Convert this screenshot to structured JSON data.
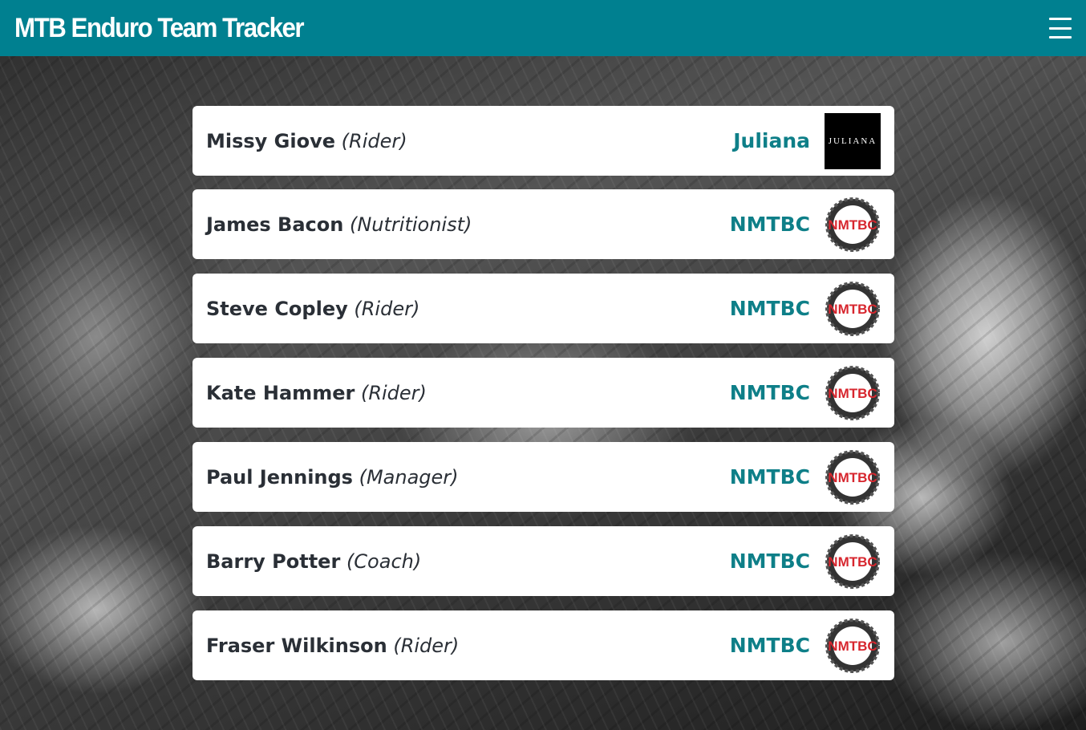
{
  "app": {
    "title": "MTB Enduro Team Tracker"
  },
  "header": {
    "menu_icon": "hamburger-menu-icon"
  },
  "colors": {
    "brand": "#008090",
    "accent": "#0e7f88",
    "card_bg": "#ffffff",
    "text": "#2a2f36"
  },
  "team": [
    {
      "name": "Missy Giove",
      "role": "(Rider)",
      "sponsor": "Juliana",
      "logo": "juliana-logo",
      "logo_text": "JULIANA"
    },
    {
      "name": "James Bacon",
      "role": "(Nutritionist)",
      "sponsor": "NMTBC",
      "logo": "nmtbc-logo",
      "logo_text": "NMTBC"
    },
    {
      "name": "Steve Copley",
      "role": "(Rider)",
      "sponsor": "NMTBC",
      "logo": "nmtbc-logo",
      "logo_text": "NMTBC"
    },
    {
      "name": "Kate Hammer",
      "role": "(Rider)",
      "sponsor": "NMTBC",
      "logo": "nmtbc-logo",
      "logo_text": "NMTBC"
    },
    {
      "name": "Paul Jennings",
      "role": "(Manager)",
      "sponsor": "NMTBC",
      "logo": "nmtbc-logo",
      "logo_text": "NMTBC"
    },
    {
      "name": "Barry Potter",
      "role": "(Coach)",
      "sponsor": "NMTBC",
      "logo": "nmtbc-logo",
      "logo_text": "NMTBC"
    },
    {
      "name": "Fraser Wilkinson",
      "role": "(Rider)",
      "sponsor": "NMTBC",
      "logo": "nmtbc-logo",
      "logo_text": "NMTBC"
    }
  ]
}
